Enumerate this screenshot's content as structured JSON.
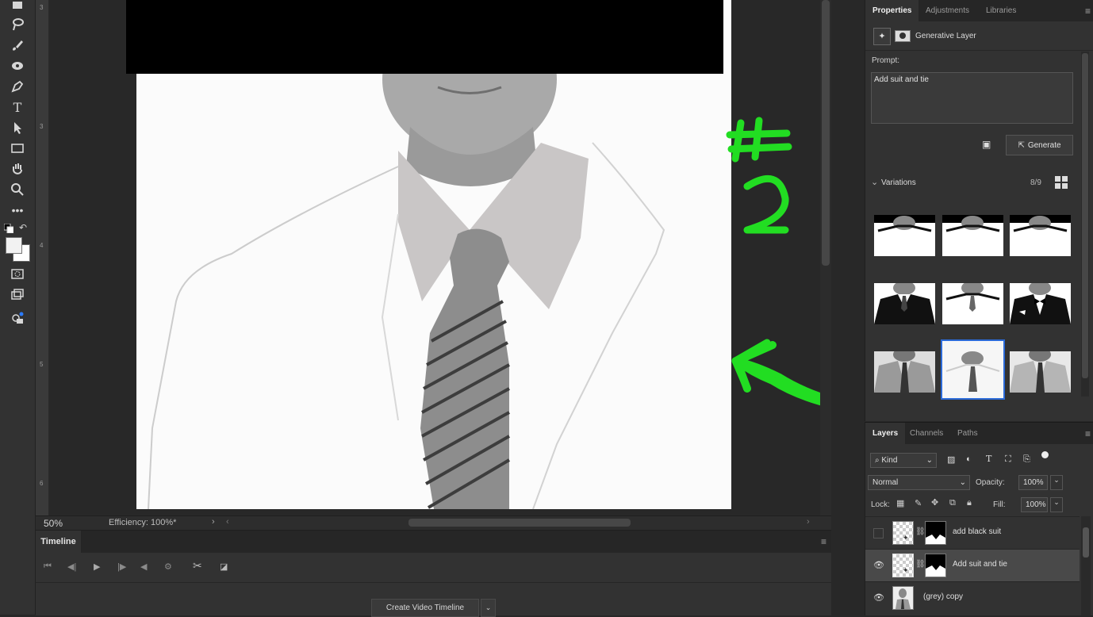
{
  "status": {
    "zoom": "50%",
    "efficiency": "Efficiency: 100%*"
  },
  "ruler": {
    "marks": [
      "3",
      "3",
      "4",
      "5",
      "6"
    ]
  },
  "timeline": {
    "tab": "Timeline",
    "create_button": "Create Video Timeline"
  },
  "properties": {
    "tabs": [
      "Properties",
      "Adjustments",
      "Libraries"
    ],
    "layer_type": "Generative Layer",
    "prompt_label": "Prompt:",
    "prompt_value": "Add suit and tie",
    "generate_label": "Generate",
    "variations_label": "Variations",
    "variations_count": "8/9"
  },
  "layers": {
    "tabs": [
      "Layers",
      "Channels",
      "Paths"
    ],
    "filter_kind": "Kind",
    "blend_mode": "Normal",
    "opacity_label": "Opacity:",
    "opacity_value": "100%",
    "lock_label": "Lock:",
    "fill_label": "Fill:",
    "fill_value": "100%",
    "items": [
      {
        "name": "add black suit",
        "visible": false
      },
      {
        "name": "Add suit and tie",
        "visible": true,
        "selected": true
      },
      {
        "name": "(grey) copy",
        "visible": true
      }
    ]
  },
  "annotation": {
    "text": "#2",
    "color": "#22dd22"
  }
}
